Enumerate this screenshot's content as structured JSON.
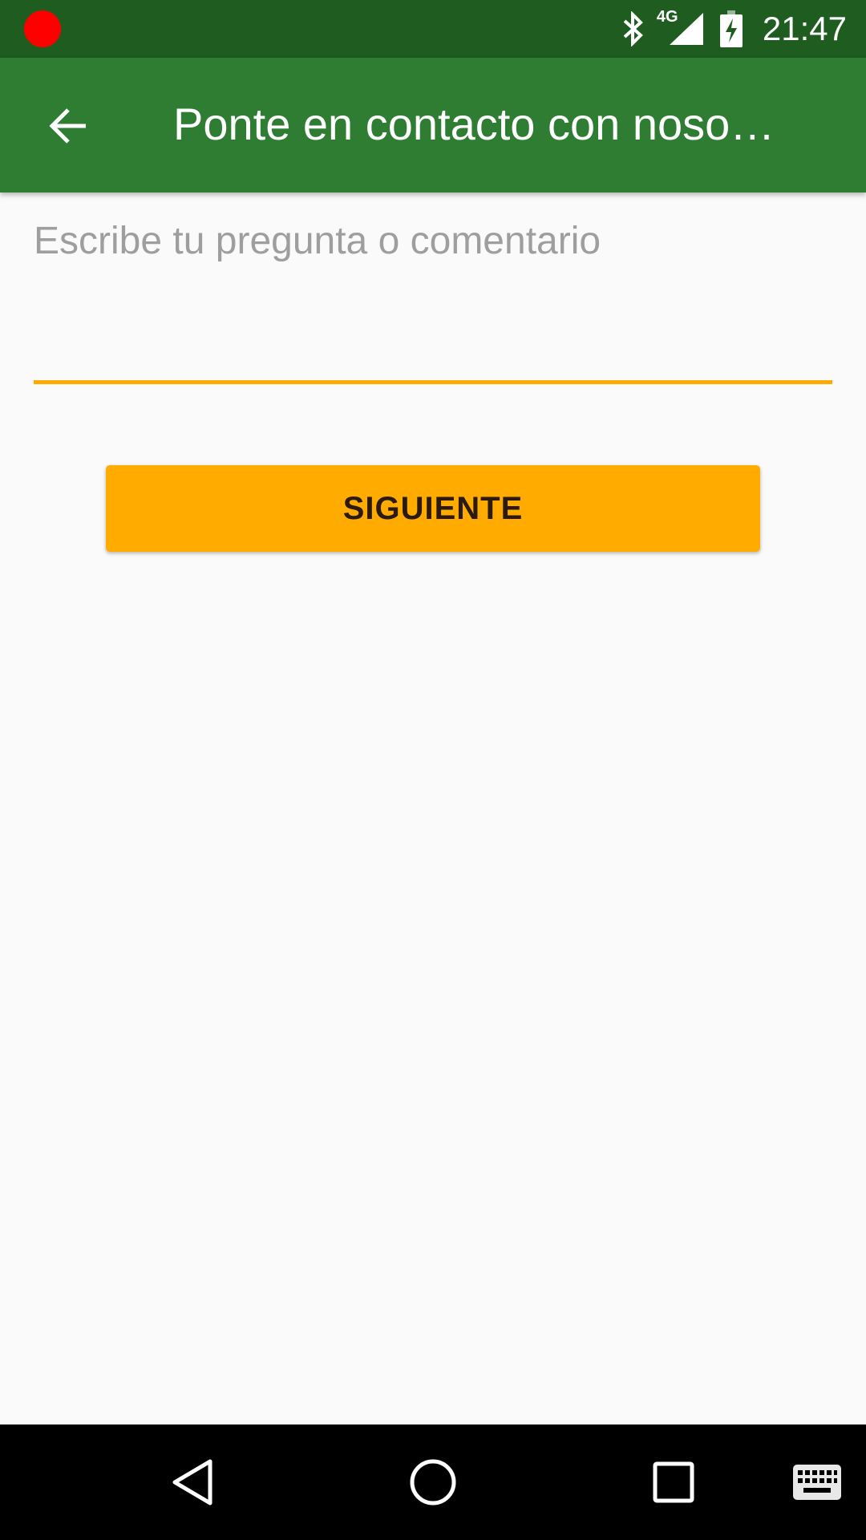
{
  "status_bar": {
    "time": "21:47",
    "network_label": "4G",
    "icons": [
      "recording-indicator-icon",
      "bluetooth-icon",
      "signal-4g-icon",
      "battery-charging-icon"
    ]
  },
  "app_bar": {
    "title": "Ponte en contacto con noso…",
    "back_icon": "arrow-back-icon"
  },
  "form": {
    "question_placeholder": "Escribe tu pregunta o comentario",
    "question_value": "",
    "next_label": "SIGUIENTE"
  },
  "nav_bar": {
    "icons": [
      "nav-back-icon",
      "nav-home-icon",
      "nav-recents-icon",
      "keyboard-icon"
    ]
  },
  "colors": {
    "status_bar": "#1e5c20",
    "app_bar": "#2e7d32",
    "accent": "#ffab00",
    "background": "#fafafa",
    "recording": "#ff0000"
  }
}
